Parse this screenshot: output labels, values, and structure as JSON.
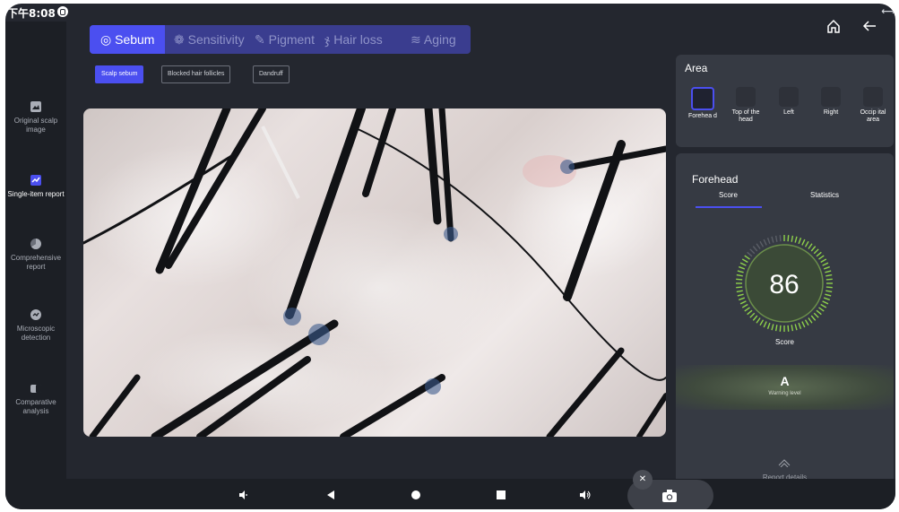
{
  "status": {
    "time": "下午8:08"
  },
  "top_icons": {
    "home_icon": "home-icon",
    "back_icon": "back-arrow-icon"
  },
  "sidebar": {
    "items": [
      {
        "label": "Original scalp image",
        "icon": "image-icon",
        "active": false
      },
      {
        "label": "Single-item report",
        "icon": "trend-chart-icon",
        "active": true
      },
      {
        "label": "Comprehensive report",
        "icon": "pie-chart-icon",
        "active": false
      },
      {
        "label": "Microscopic detection",
        "icon": "microscope-icon",
        "active": false
      },
      {
        "label": "Comparative analysis",
        "icon": "compare-icon",
        "active": false
      }
    ]
  },
  "tabs": [
    {
      "label": "Sebum",
      "active": true
    },
    {
      "label": "Sensitivity",
      "active": false
    },
    {
      "label": "Pigment",
      "active": false
    },
    {
      "label": "Hair loss",
      "active": false
    },
    {
      "label": "Aging",
      "active": false
    }
  ],
  "chips": [
    {
      "label": "Scalp sebum",
      "active": true
    },
    {
      "label": "Blocked hair follicles",
      "active": false
    },
    {
      "label": "Dandruff",
      "active": false
    }
  ],
  "area": {
    "title": "Area",
    "items": [
      {
        "label": "Forehea d",
        "active": true
      },
      {
        "label": "Top of the head",
        "active": false
      },
      {
        "label": "Left",
        "active": false
      },
      {
        "label": "Right",
        "active": false
      },
      {
        "label": "Occip ital area",
        "active": false
      }
    ]
  },
  "detail": {
    "title": "Forehead",
    "tabs": [
      "Score",
      "Statistics"
    ],
    "score": "86",
    "score_label": "Score",
    "score_fraction": 0.86,
    "grade": "A",
    "grade_label": "Warning level",
    "report_label": "Report details"
  },
  "colors": {
    "accent": "#4b4ff0",
    "gauge": "#8ed14a",
    "panel": "#363a43",
    "bg": "#24272f"
  }
}
